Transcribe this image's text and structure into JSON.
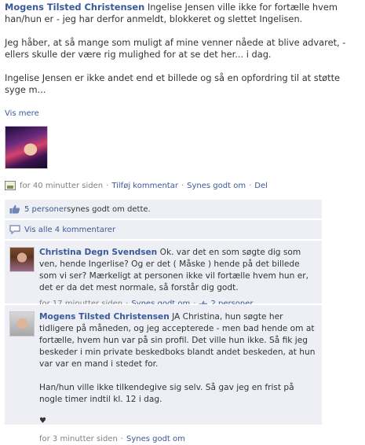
{
  "post": {
    "author": "Mogens Tilsted Christensen",
    "text_line1": " Ingelise Jensen ville ikke for fortælle hvem han/hun er - jeg har derfor anmeldt, blokkeret og slettet Ingelisen.",
    "paragraph2": "Jeg håber, at så mange som muligt af mine venner nåede at blive advaret, - ellers skulle der være rig mulighed for at se det her... i dag.",
    "paragraph3": "Ingelise Jensen er ikke andet end et billede og så en opfordring til at støtte syge m...",
    "see_more": "Vis mere",
    "timestamp": "for 40 minutter siden",
    "add_comment": "Tilføj kommentar",
    "like": "Synes godt om",
    "share": "Del",
    "separator": "·"
  },
  "feedback": {
    "likes_link": "5 personer",
    "likes_suffix": " synes godt om dette.",
    "view_all": "Vis alle 4 kommentarer"
  },
  "comments": [
    {
      "author": "Christina Degn Svendsen",
      "text": " Ok. var det en som søgte dig som ven, hende Ingerlise? Og er det ( Måske ) hende på det billede som vi ser? Mærkeligt at personen ikke vil fortælle hvem hun er, det er da det mest normale, så forstår dig godt.",
      "timestamp": "for 17 minutter siden",
      "like": "Synes godt om",
      "like_count": "2 personer"
    },
    {
      "author": "Mogens Tilsted Christensen",
      "text": " JA Christina, hun søgte her tidligere på måneden, og jeg accepterede - men bad hende om at fortælle, hvem hun var på sin profil. Det ville hun ikke. Så fik jeg beskeder i min private beskedboks blandt andet beskeden, at hun var var en mand i stedet for.",
      "text2": "Han/hun ville ikke tilkendegive sig selv. Så gav jeg en frist på nogle timer indtil kl. 12 i dag.",
      "heart": "♥",
      "timestamp": "for 3 minutter siden",
      "like": "Synes godt om"
    }
  ],
  "colors": {
    "link": "#3b5998",
    "feedback_bg": "#edeff4",
    "meta_gray": "#808080"
  }
}
